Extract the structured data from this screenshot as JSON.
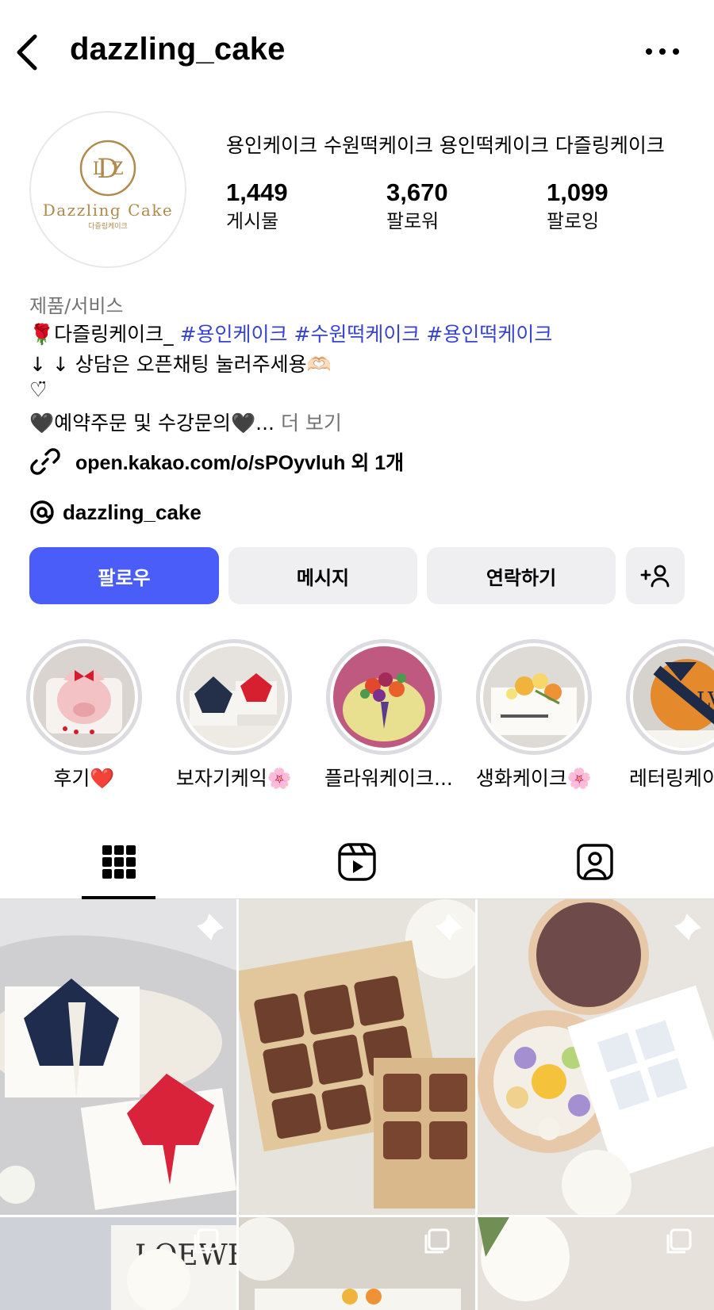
{
  "header": {
    "username": "dazzling_cake"
  },
  "avatar": {
    "brand_name": "Dazzling Cake",
    "brand_sub": "다즐링케이크",
    "monogram": "DLZ"
  },
  "profile": {
    "name": "용인케이크 수원떡케이크 용인떡케이크 다즐링케이크",
    "stats": [
      {
        "value": "1,449",
        "label": "게시물"
      },
      {
        "value": "3,670",
        "label": "팔로워"
      },
      {
        "value": "1,099",
        "label": "팔로잉"
      }
    ],
    "category": "제품/서비스",
    "bio": {
      "line1_prefix": "🌹다즐링케이크_ ",
      "line1_hashtags": "#용인케이크 #수원떡케이크 #용인떡케이크",
      "line2": "↓ ↓ 상담은 오픈채팅 눌러주세용🫶🏻",
      "line3": "♡̈",
      "line4": "🖤예약주문 및 수강문의🖤...",
      "more": " 더 보기"
    },
    "link": "open.kakao.com/o/sPOyvluh 외 1개",
    "threads": "dazzling_cake"
  },
  "actions": {
    "follow": "팔로우",
    "message": "메시지",
    "contact": "연락하기"
  },
  "highlights": [
    {
      "label": "후기❤️"
    },
    {
      "label": "보자기케익🌸"
    },
    {
      "label": "플라워케이크..."
    },
    {
      "label": "생화케이크🌸"
    },
    {
      "label": "레터링케이크"
    }
  ],
  "tabs": [
    "posts",
    "reels",
    "tagged"
  ],
  "colors": {
    "accent": "#4a5df9",
    "hashtag": "#3843d0",
    "muted": "#737373",
    "button_gray": "#efeff2"
  }
}
